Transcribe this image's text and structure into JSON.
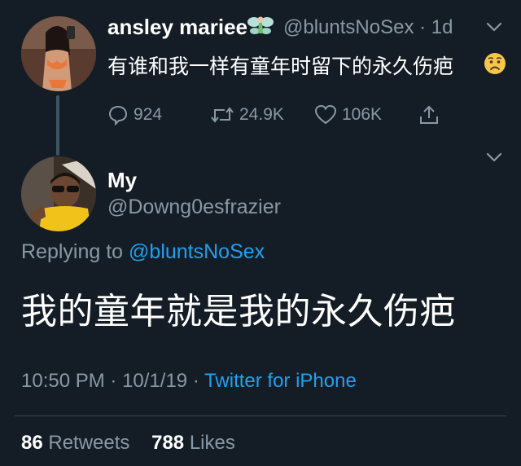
{
  "parent_tweet": {
    "display_name": "ansley mariee",
    "name_emoji_icon": "fairy-icon",
    "handle": "@bluntsNoSex",
    "age": "1d",
    "text": "有谁和我一样有童年时留下的永久伤疤",
    "text_emoji_icon": "worried-face-icon",
    "replies": "924",
    "retweets": "24.9K",
    "likes": "106K"
  },
  "reply_tweet": {
    "display_name": "My",
    "handle": "@Downg0esfrazier",
    "replying_prefix": "Replying to",
    "replying_to": "@bluntsNoSex",
    "text": "我的童年就是我的永久伤疤",
    "time": "10:50 PM",
    "date": "10/1/19",
    "source": "Twitter for iPhone",
    "retweet_count": "86",
    "retweet_label": "Retweets",
    "like_count": "788",
    "like_label": "Likes"
  },
  "colors": {
    "background": "#141d26",
    "muted": "#8899a6",
    "link": "#1da1f2",
    "divider": "#38444d"
  }
}
